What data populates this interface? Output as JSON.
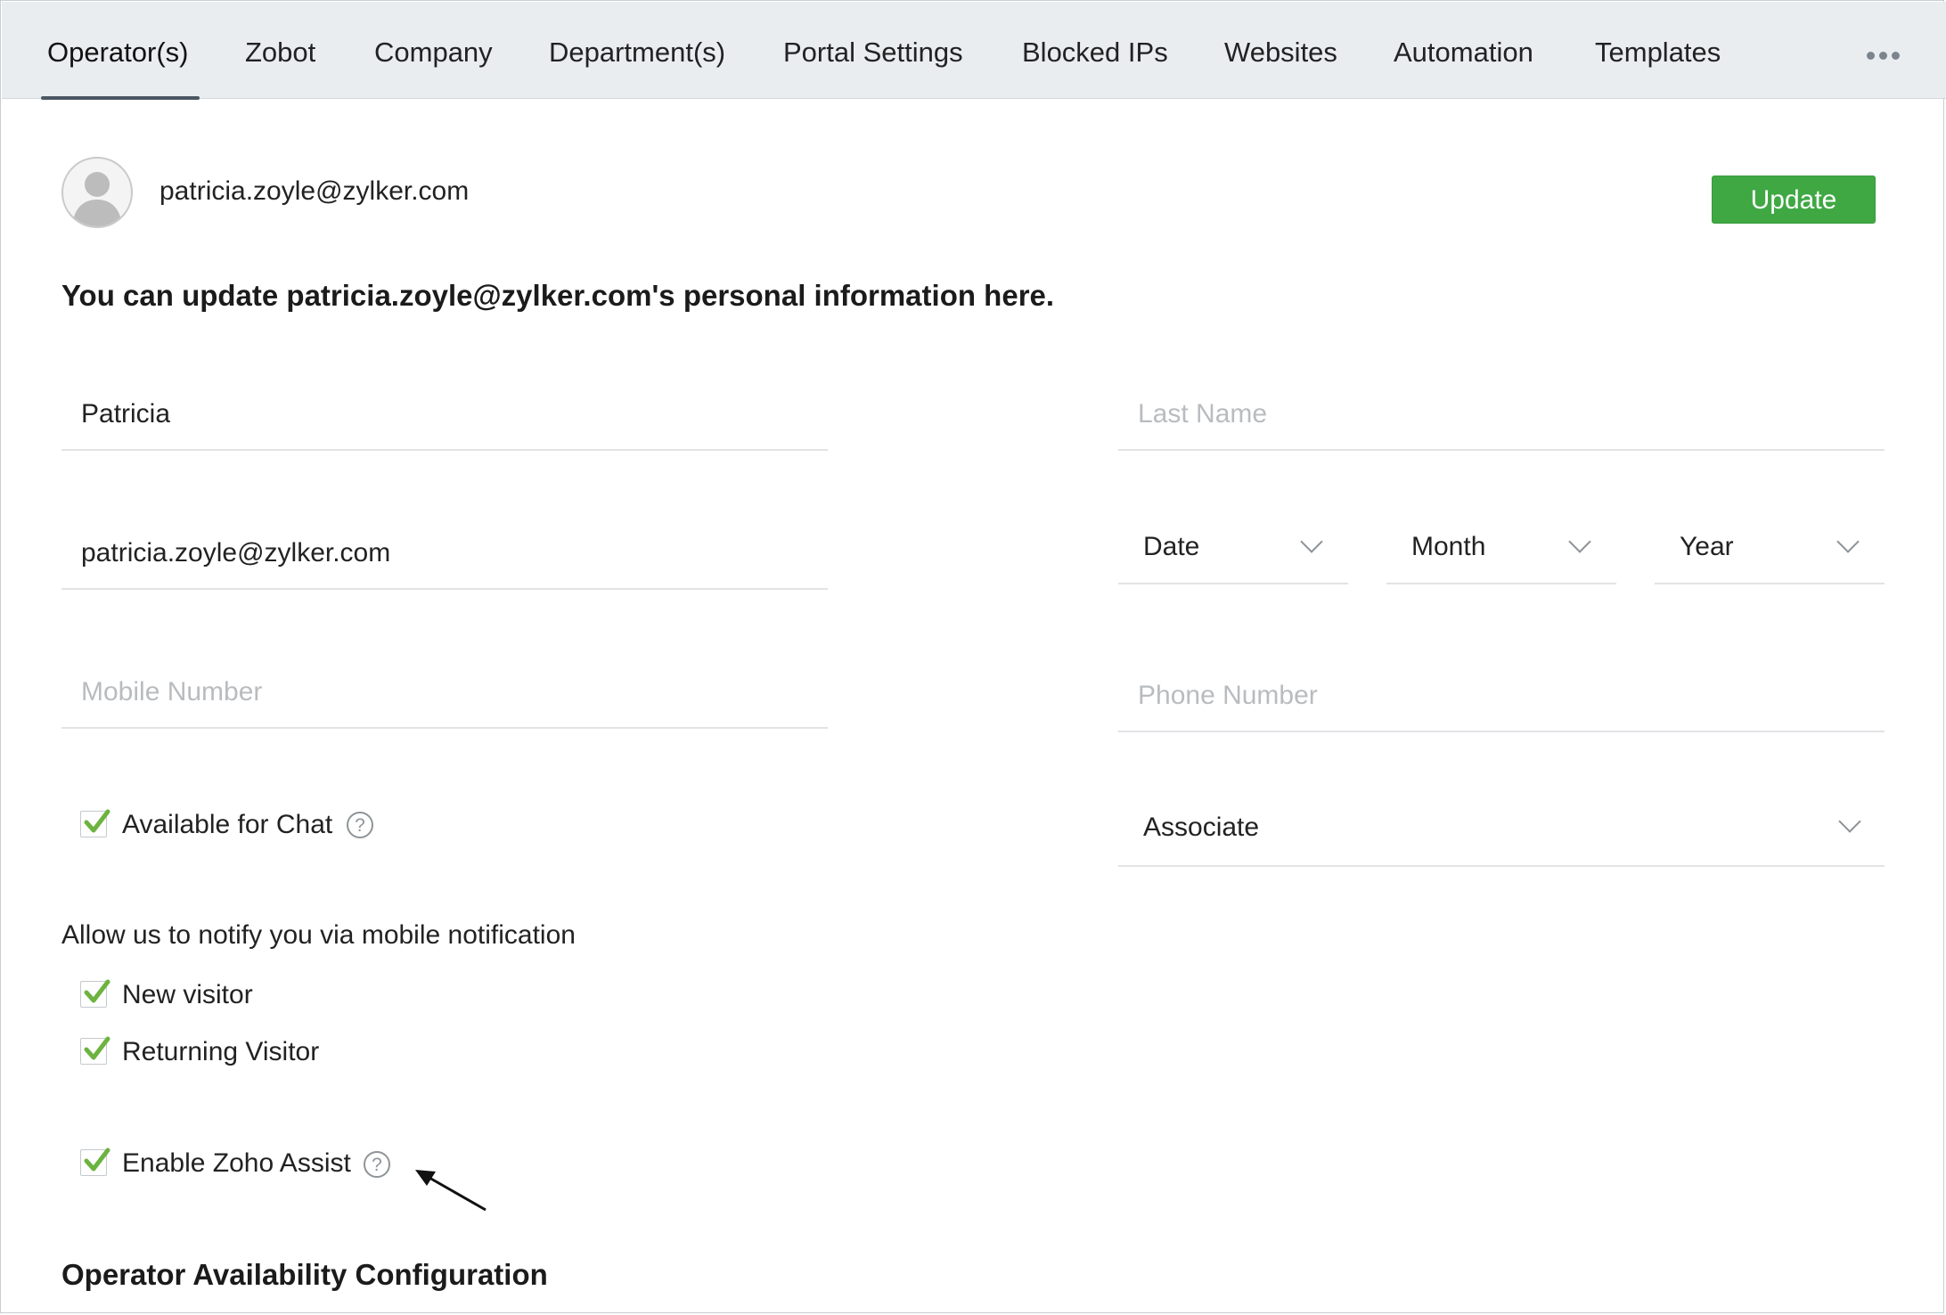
{
  "tabs": [
    {
      "label": "Operator(s)",
      "active": true
    },
    {
      "label": "Zobot"
    },
    {
      "label": "Company"
    },
    {
      "label": "Department(s)"
    },
    {
      "label": "Portal Settings"
    },
    {
      "label": "Blocked IPs"
    },
    {
      "label": "Websites"
    },
    {
      "label": "Automation"
    },
    {
      "label": "Templates"
    }
  ],
  "more_icon": "ellipsis-icon",
  "header": {
    "email": "patricia.zoyle@zylker.com",
    "update_label": "Update",
    "update_color": "#3fa843"
  },
  "intro_text": "You can update patricia.zoyle@zylker.com's personal information here.",
  "form": {
    "first_name": {
      "value": "Patricia",
      "placeholder": ""
    },
    "last_name": {
      "value": "",
      "placeholder": "Last Name"
    },
    "email": {
      "value": "patricia.zoyle@zylker.com",
      "placeholder": ""
    },
    "dob": {
      "date": "Date",
      "month": "Month",
      "year": "Year"
    },
    "mobile": {
      "value": "",
      "placeholder": "Mobile Number"
    },
    "phone": {
      "value": "",
      "placeholder": "Phone Number"
    },
    "role": "Associate"
  },
  "checkboxes": {
    "available_for_chat": {
      "label": "Available for Chat",
      "checked": true
    },
    "notify_label": "Allow us to notify you via mobile notification",
    "new_visitor": {
      "label": "New visitor",
      "checked": true
    },
    "returning_visitor": {
      "label": "Returning Visitor",
      "checked": true
    },
    "zoho_assist": {
      "label": "Enable Zoho Assist",
      "checked": true
    }
  },
  "help_glyph": "?",
  "section_heading": "Operator Availability Configuration",
  "check_color": "#6cb33f"
}
